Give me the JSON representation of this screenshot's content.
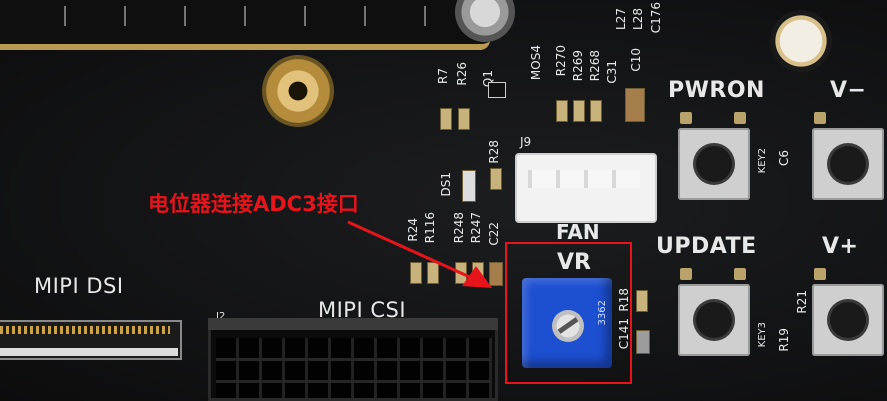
{
  "annotation": {
    "label": "电位器连接ADC3接口",
    "color": "#e8141b"
  },
  "silkscreen": {
    "pwron": "PWRON",
    "vminus": "V−",
    "update": "UPDATE",
    "vplus": "V+",
    "fan": "FAN",
    "vr": "VR",
    "mipi_dsi": "MIPI DSI",
    "mipi_csi": "MIPI CSI",
    "j9": "J9",
    "j2": "J2",
    "ds1": "DS1",
    "r7": "R7",
    "r26": "R26",
    "q1": "Q1",
    "mos4": "MOS4",
    "r270": "R270",
    "r269": "R269",
    "r268": "R268",
    "c31": "C31",
    "c10": "C10",
    "l27": "L27",
    "l28": "L28",
    "c176": "C176",
    "r28": "R28",
    "r24": "R24",
    "r116": "R116",
    "r248": "R248",
    "r247": "R247",
    "c22": "C22",
    "c141": "C141",
    "r18": "R18",
    "key2": "KEY2",
    "key3": "KEY3",
    "c6": "C6",
    "r19": "R19",
    "r21": "R21",
    "pot_marking": "3362"
  },
  "colors": {
    "pcb": "#141516",
    "silkscreen": "#e8e8e8",
    "pot_blue": "#1d4fd1",
    "button_body": "#cfcfcf",
    "connector_white": "#f2f2f2",
    "standoff_gold": "#c9a24a"
  }
}
